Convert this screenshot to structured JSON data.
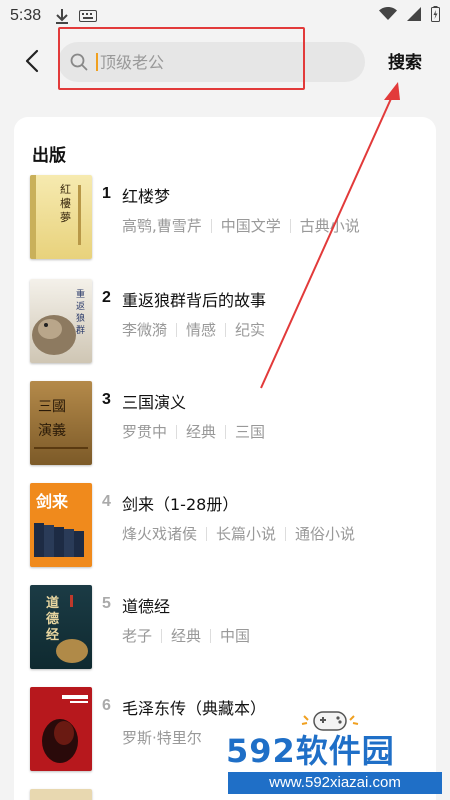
{
  "status_bar": {
    "time": "5:38"
  },
  "search": {
    "placeholder": "顶级老公",
    "submit_label": "搜索"
  },
  "section": {
    "title": "出版"
  },
  "books": [
    {
      "rank": "1",
      "title": "红楼梦",
      "tags": [
        "高鹗,曹雪芹",
        "中国文学",
        "古典小说"
      ],
      "cover_text": "红楼梦"
    },
    {
      "rank": "2",
      "title": "重返狼群背后的故事",
      "tags": [
        "李微漪",
        "情感",
        "纪实"
      ],
      "cover_text": "重返狼群"
    },
    {
      "rank": "3",
      "title": "三国演义",
      "tags": [
        "罗贯中",
        "经典",
        "三国"
      ],
      "cover_text": "三国演义"
    },
    {
      "rank": "4",
      "title": "剑来（1-28册）",
      "tags": [
        "烽火戏诸侯",
        "长篇小说",
        "通俗小说"
      ],
      "cover_text": "剑来"
    },
    {
      "rank": "5",
      "title": "道德经",
      "tags": [
        "老子",
        "经典",
        "中国"
      ],
      "cover_text": "道德经"
    },
    {
      "rank": "6",
      "title": "毛泽东传（典藏本）",
      "tags": [
        "罗斯·特里尔"
      ],
      "cover_text": ""
    }
  ],
  "watermark": {
    "brand": "592软件园",
    "url": "www.592xiazai.com"
  },
  "colors": {
    "annotation": "#e23a3a",
    "accent": "#f0a020",
    "watermark": "#1f6fc7"
  },
  "icons": [
    "download-icon",
    "keyboard-icon",
    "wifi-icon",
    "signal-icon",
    "battery-icon",
    "back-arrow-icon",
    "search-icon"
  ]
}
